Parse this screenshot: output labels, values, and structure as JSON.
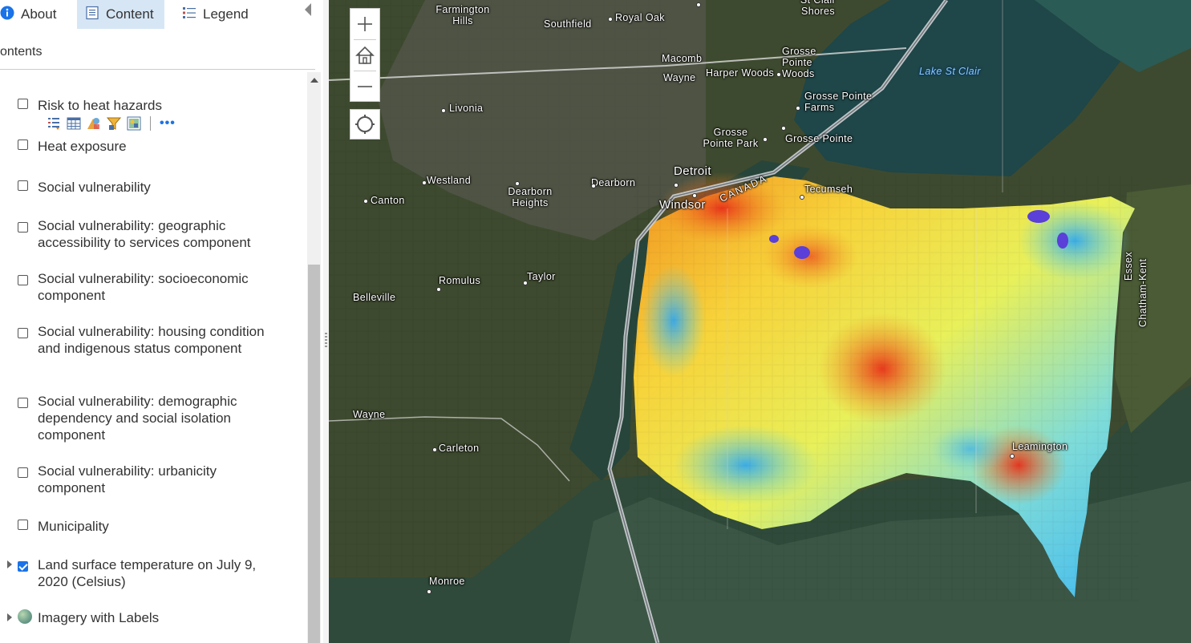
{
  "tabs": [
    {
      "label": "About",
      "icon": "info-icon"
    },
    {
      "label": "Content",
      "icon": "content-icon",
      "active": true
    },
    {
      "label": "Legend",
      "icon": "legend-icon"
    }
  ],
  "content_header": "ontents",
  "layers": [
    {
      "label": "Risk to heat hazards",
      "checked": false
    },
    {
      "label": "Heat exposure",
      "checked": false
    },
    {
      "label": "Social vulnerability",
      "checked": false
    },
    {
      "label": "Social vulnerability: geographic accessibility to services component",
      "checked": false
    },
    {
      "label": "Social vulnerability: socioeconomic component",
      "checked": false
    },
    {
      "label": "Social vulnerability: housing condition and indigenous status component",
      "checked": false
    },
    {
      "label": "Social vulnerability: demographic dependency and social isolation component",
      "checked": false
    },
    {
      "label": "Social vulnerability: urbanicity component",
      "checked": false
    },
    {
      "label": "Municipality",
      "checked": false
    },
    {
      "label": "Land surface temperature on July 9, 2020 (Celsius)",
      "checked": true
    },
    {
      "label": "Imagery with Labels",
      "checked": null
    }
  ],
  "layer_tools": [
    "table-of-contents-icon",
    "attribute-table-icon",
    "change-style-icon",
    "filter-icon",
    "imagery-icon",
    "more-icon"
  ],
  "map": {
    "controls": {
      "zoom_in": "+",
      "zoom_out": "−"
    },
    "labels": {
      "farmington_hills": "Farmington Hills",
      "southfield": "Southfield",
      "royal_oak": "Royal Oak",
      "st_clair_shores": "St Clair Shores",
      "macomb": "Macomb",
      "wayne_top": "Wayne",
      "harper_woods": "Harper Woods",
      "grosse_pointe_woods": "Grosse Pointe Woods",
      "lake_st_clair": "Lake St Clair",
      "livonia": "Livonia",
      "grosse_pointe_farms": "Grosse Pointe Farms",
      "grosse_pointe_park": "Grosse Pointe Park",
      "grosse_pointe": "Grosse Pointe",
      "detroit": "Detroit",
      "westland": "Westland",
      "dearborn": "Dearborn",
      "dearborn_heights": "Dearborn Heights",
      "canada": "CANADA",
      "tecumseh": "Tecumseh",
      "windsor": "Windsor",
      "canton": "Canton",
      "romulus": "Romulus",
      "taylor": "Taylor",
      "belleville": "Belleville",
      "essex": "Essex",
      "chatham_kent": "Chatham-Kent",
      "wayne_county": "Wayne",
      "carleton": "Carleton",
      "leamington": "Leamington",
      "monroe": "Monroe"
    }
  },
  "colors": {
    "active_tab": "#d6e6f5",
    "accent": "#1a73e8",
    "water": "#1f3f3f",
    "land": "#3d4a2e"
  }
}
